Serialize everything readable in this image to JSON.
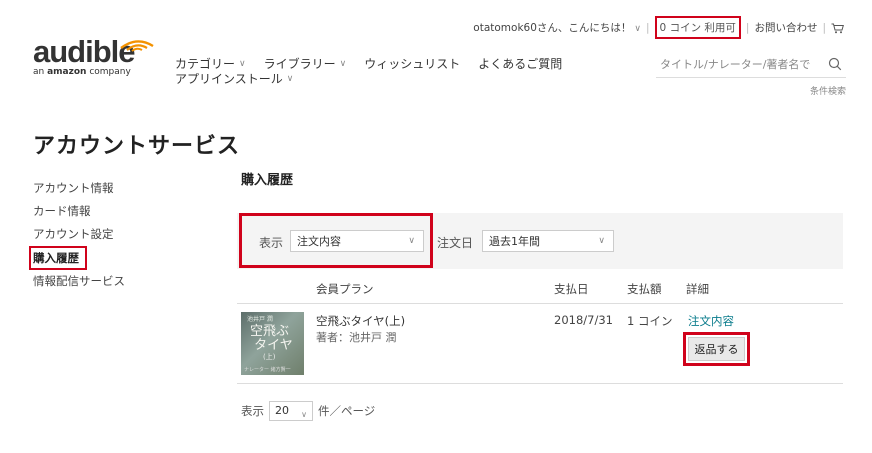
{
  "header": {
    "greeting": "otatomok60さん、こんにちは！",
    "coins": "0 コイン 利用可",
    "contact": "お問い合わせ"
  },
  "logo": {
    "word": "audible",
    "sub_prefix": "an ",
    "sub_brand": "amazon",
    "sub_suffix": " company"
  },
  "nav": {
    "categories": "カテゴリー",
    "library": "ライブラリー",
    "wishlist": "ウィッシュリスト",
    "faq": "よくあるご質問",
    "app_install": "アプリインストール"
  },
  "search": {
    "placeholder": "タイトル/ナレーター/著者名で",
    "advanced": "条件検索"
  },
  "page_title": "アカウントサービス",
  "sidebar": {
    "items": [
      {
        "label": "アカウント情報"
      },
      {
        "label": "カード情報"
      },
      {
        "label": "アカウント設定"
      },
      {
        "label": "購入履歴"
      },
      {
        "label": "情報配信サービス"
      }
    ]
  },
  "main": {
    "section_title": "購入履歴",
    "filter": {
      "display_label": "表示",
      "display_value": "注文内容",
      "date_label": "注文日",
      "date_value": "過去1年間"
    },
    "table": {
      "headers": [
        "会員プラン",
        "支払日",
        "支払額",
        "詳細"
      ],
      "rows": [
        {
          "title": "空飛ぶタイヤ(上)",
          "author": "著者：池井戸 潤",
          "date": "2018/7/31",
          "amount": "1 コイン",
          "detail_link": "注文内容",
          "return_button": "返品する",
          "cover": {
            "author": "池井戸 潤",
            "title_line1": "空飛ぶ",
            "title_line2": "タイヤ",
            "volume": "(上)",
            "narrator": "ナレーター 緒方賢一"
          }
        }
      ]
    },
    "pagination": {
      "prefix": "表示",
      "per_page": "20",
      "suffix": "件／ページ"
    }
  },
  "colors": {
    "highlight": "#d0021b",
    "link": "#0a7c8c",
    "filter_bg": "#f4f4f4"
  }
}
